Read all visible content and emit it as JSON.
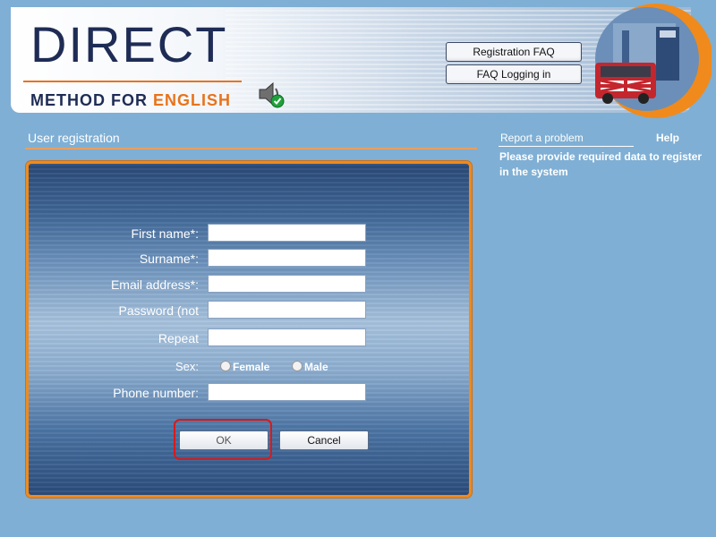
{
  "header": {
    "logo_top": "DIRECT",
    "logo_bottom_prefix": "METHOD FOR ",
    "logo_bottom_highlight": "ENGLISH",
    "buttons": [
      {
        "label": "Registration FAQ"
      },
      {
        "label": "FAQ Logging in"
      }
    ],
    "icons": {
      "speaker": "speaker-check-icon",
      "badge": "london-bus-icon"
    },
    "colors": {
      "accent": "#e8731c",
      "brand": "#1e2c55"
    }
  },
  "main": {
    "title": "User registration",
    "form": {
      "fields": [
        {
          "label": "First name*:",
          "value": ""
        },
        {
          "label": "Surname*:",
          "value": ""
        },
        {
          "label": "Email address*:",
          "value": ""
        },
        {
          "label": "Password (not",
          "value": ""
        },
        {
          "label": "Repeat",
          "value": ""
        }
      ],
      "sex": {
        "label": "Sex:",
        "options": [
          "Female",
          "Male"
        ]
      },
      "phone": {
        "label": "Phone number:",
        "value": ""
      },
      "ok_label": "OK",
      "cancel_label": "Cancel"
    }
  },
  "sidebar": {
    "report_link": "Report a problem",
    "help_title": "Help",
    "help_text": "Please provide required data to register in the system"
  }
}
